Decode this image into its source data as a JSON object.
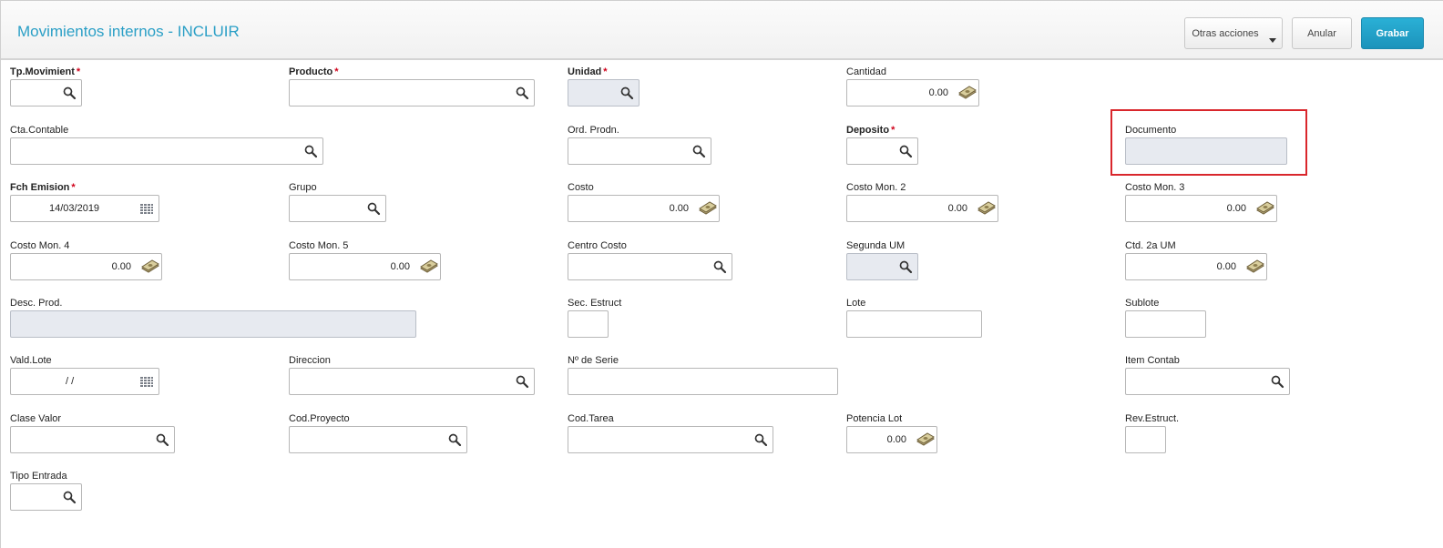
{
  "header": {
    "title": "Movimientos internos - INCLUIR",
    "actions": {
      "otras_acciones": "Otras acciones",
      "anular": "Anular",
      "grabar": "Grabar"
    }
  },
  "form": {
    "tp_movimient": {
      "label": "Tp.Movimient",
      "value": ""
    },
    "producto": {
      "label": "Producto",
      "value": ""
    },
    "unidad": {
      "label": "Unidad",
      "value": ""
    },
    "cantidad": {
      "label": "Cantidad",
      "value": "0.00"
    },
    "cta_contable": {
      "label": "Cta.Contable",
      "value": ""
    },
    "ord_prodn": {
      "label": "Ord. Prodn.",
      "value": ""
    },
    "deposito": {
      "label": "Deposito",
      "value": ""
    },
    "documento": {
      "label": "Documento",
      "value": ""
    },
    "fch_emision": {
      "label": "Fch Emision",
      "value": "14/03/2019"
    },
    "grupo": {
      "label": "Grupo",
      "value": ""
    },
    "costo": {
      "label": "Costo",
      "value": "0.00"
    },
    "costo_mon2": {
      "label": "Costo Mon. 2",
      "value": "0.00"
    },
    "costo_mon3": {
      "label": "Costo Mon. 3",
      "value": "0.00"
    },
    "costo_mon4": {
      "label": "Costo Mon. 4",
      "value": "0.00"
    },
    "costo_mon5": {
      "label": "Costo Mon. 5",
      "value": "0.00"
    },
    "centro_costo": {
      "label": "Centro Costo",
      "value": ""
    },
    "segunda_um": {
      "label": "Segunda UM",
      "value": ""
    },
    "ctd_2a_um": {
      "label": "Ctd. 2a UM",
      "value": "0.00"
    },
    "desc_prod": {
      "label": "Desc. Prod.",
      "value": ""
    },
    "sec_estruct": {
      "label": "Sec. Estruct",
      "value": ""
    },
    "lote": {
      "label": "Lote",
      "value": ""
    },
    "sublote": {
      "label": "Sublote",
      "value": ""
    },
    "vald_lote": {
      "label": "Vald.Lote",
      "value": "/  /"
    },
    "direccion": {
      "label": "Direccion",
      "value": ""
    },
    "nro_serie": {
      "label": "Nº de Serie",
      "value": ""
    },
    "item_contab": {
      "label": "Item Contab",
      "value": ""
    },
    "clase_valor": {
      "label": "Clase Valor",
      "value": ""
    },
    "cod_proyecto": {
      "label": "Cod.Proyecto",
      "value": ""
    },
    "cod_tarea": {
      "label": "Cod.Tarea",
      "value": ""
    },
    "potencia_lot": {
      "label": "Potencia Lot",
      "value": "0.00"
    },
    "rev_estruct": {
      "label": "Rev.Estruct.",
      "value": ""
    },
    "tipo_entrada": {
      "label": "Tipo Entrada",
      "value": ""
    }
  },
  "colors": {
    "accent": "#2a9fc6",
    "primary_button": "#1c93bb",
    "required": "#d0021b",
    "highlight": "#d9262c",
    "disabled_field": "#e7eaf0"
  },
  "icons": {
    "lookup": "search-icon",
    "date": "calendar-icon",
    "amount": "money-icon"
  }
}
